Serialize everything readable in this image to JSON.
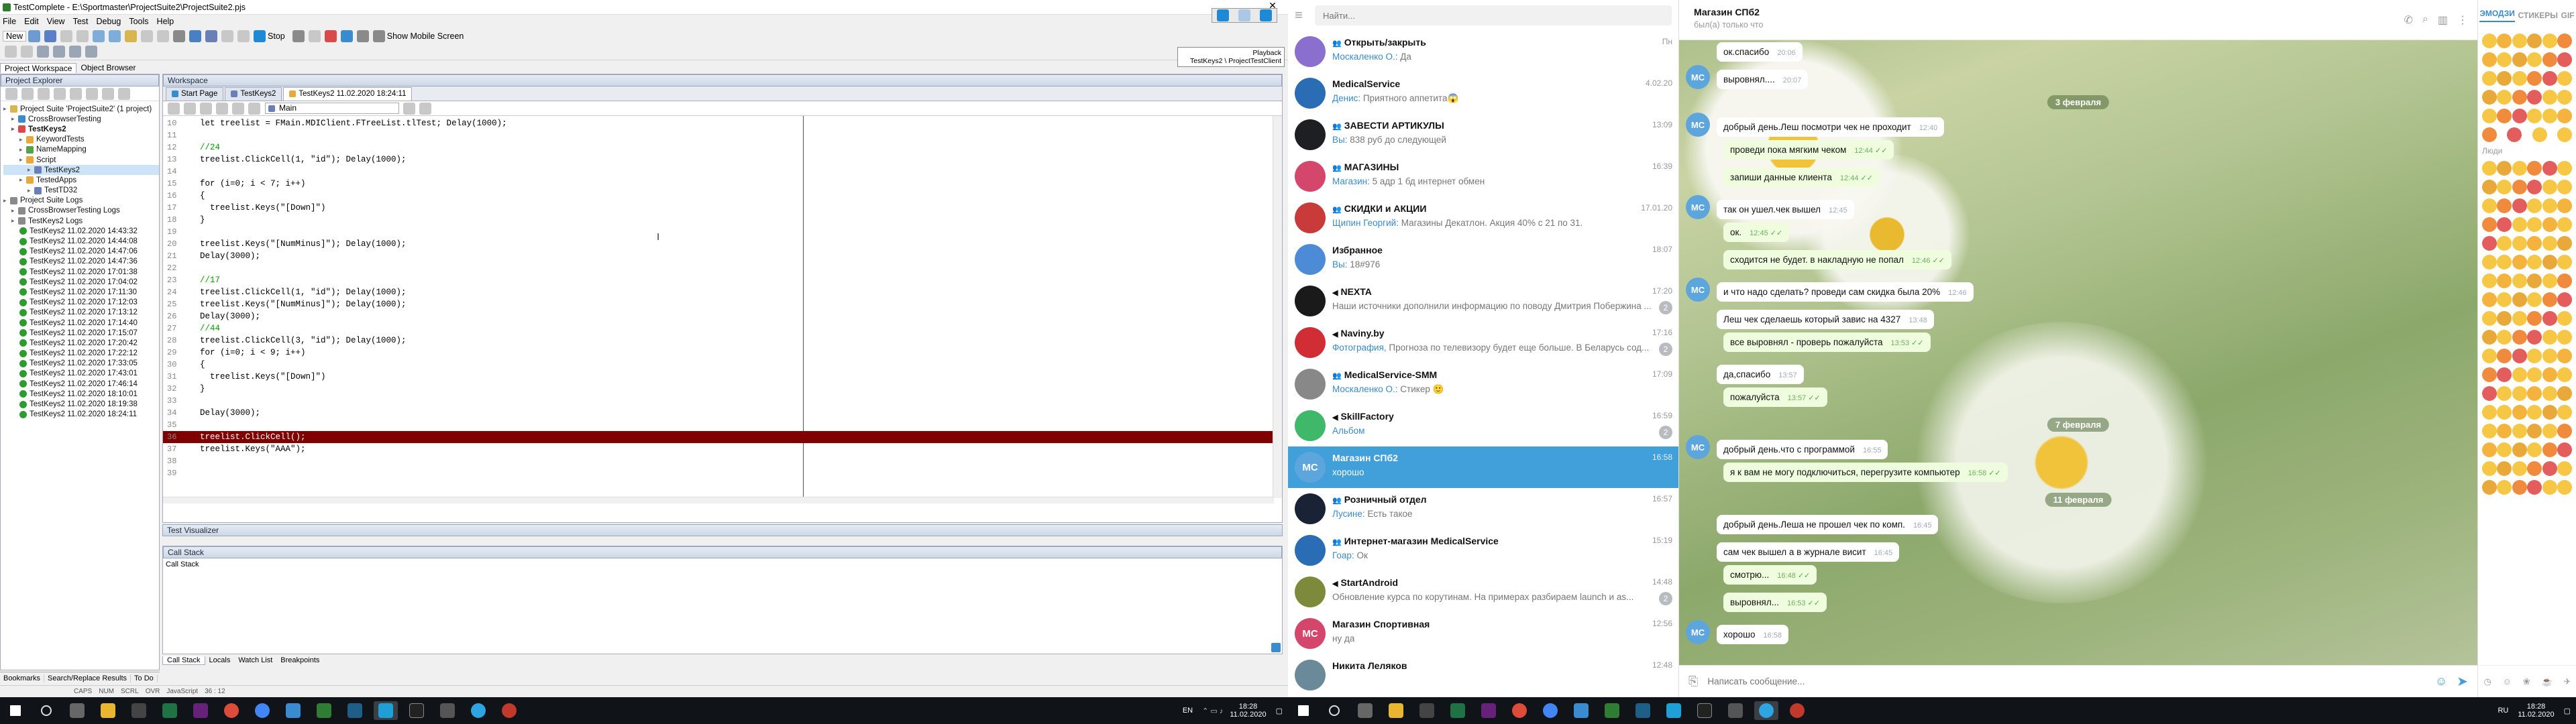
{
  "tc": {
    "title": "TestComplete - E:\\Sportmaster\\ProjectSuite2\\ProjectSuite2.pjs",
    "menu": [
      "File",
      "Edit",
      "View",
      "Test",
      "Debug",
      "Tools",
      "Help"
    ],
    "new_label": "New",
    "stop_label": "Stop",
    "mobile_label": "Show Mobile Screen",
    "tabs_left": [
      "Project Workspace",
      "Object Browser"
    ],
    "explorer_title": "Project Explorer",
    "workspace_title": "Workspace",
    "doc_tabs": [
      "Start Page",
      "TestKeys2",
      "TestKeys2 11.02.2020 18:24:11"
    ],
    "routine": "Main",
    "playback_title": "Playback",
    "playback_caption": "TestKeys2 \\ ProjectTestClient",
    "tree": [
      {
        "t": "Project Suite 'ProjectSuite2' (1 project)",
        "d": 0,
        "c": "#d9b550"
      },
      {
        "t": "CrossBrowserTesting",
        "d": 1,
        "c": "#3b8bd1"
      },
      {
        "t": "TestKeys2",
        "d": 1,
        "c": "#d94b4b",
        "b": true
      },
      {
        "t": "KeywordTests",
        "d": 2,
        "c": "#e7a93c"
      },
      {
        "t": "NameMapping",
        "d": 2,
        "c": "#54a24c"
      },
      {
        "t": "Script",
        "d": 2,
        "c": "#e7a93c"
      },
      {
        "t": "TestKeys2",
        "d": 3,
        "c": "#6a7fb5",
        "sel": true
      },
      {
        "t": "TestedApps",
        "d": 2,
        "c": "#e7a93c"
      },
      {
        "t": "TestTD32",
        "d": 3,
        "c": "#6a7fb5"
      },
      {
        "t": "Project Suite Logs",
        "d": 0,
        "c": "#8a8a8a"
      },
      {
        "t": "CrossBrowserTesting Logs",
        "d": 1,
        "c": "#8a8a8a"
      },
      {
        "t": "TestKeys2 Logs",
        "d": 1,
        "c": "#8a8a8a"
      }
    ],
    "logs": [
      "TestKeys2 11.02.2020 14:43:32",
      "TestKeys2 11.02.2020 14:44:08",
      "TestKeys2 11.02.2020 14:47:06",
      "TestKeys2 11.02.2020 14:47:36",
      "TestKeys2 11.02.2020 17:01:38",
      "TestKeys2 11.02.2020 17:04:02",
      "TestKeys2 11.02.2020 17:11:30",
      "TestKeys2 11.02.2020 17:12:03",
      "TestKeys2 11.02.2020 17:13:12",
      "TestKeys2 11.02.2020 17:14:40",
      "TestKeys2 11.02.2020 17:15:07",
      "TestKeys2 11.02.2020 17:20:42",
      "TestKeys2 11.02.2020 17:22:12",
      "TestKeys2 11.02.2020 17:33:05",
      "TestKeys2 11.02.2020 17:43:01",
      "TestKeys2 11.02.2020 17:46:14",
      "TestKeys2 11.02.2020 18:10:01",
      "TestKeys2 11.02.2020 18:19:38",
      "TestKeys2 11.02.2020 18:24:11"
    ],
    "code": [
      {
        "n": "10",
        "t": "  let treelist = FMain.MDIClient.FTreeList.tlTest; Delay(1000);",
        "k": "code"
      },
      {
        "n": "11",
        "t": "",
        "k": "code"
      },
      {
        "n": "12",
        "t": "  //24",
        "k": "cm"
      },
      {
        "n": "13",
        "t": "  treelist.ClickCell(1, \"id\"); Delay(1000);",
        "k": "code"
      },
      {
        "n": "14",
        "t": "",
        "k": "code"
      },
      {
        "n": "15",
        "t": "  for (i=0; i < 7; i++)",
        "k": "code"
      },
      {
        "n": "16",
        "t": "  {",
        "k": "code"
      },
      {
        "n": "17",
        "t": "    treelist.Keys(\"[Down]\")",
        "k": "code"
      },
      {
        "n": "18",
        "t": "  }",
        "k": "code"
      },
      {
        "n": "19",
        "t": "",
        "k": "code"
      },
      {
        "n": "20",
        "t": "  treelist.Keys(\"[NumMinus]\"); Delay(1000);",
        "k": "code"
      },
      {
        "n": "21",
        "t": "  Delay(3000);",
        "k": "code"
      },
      {
        "n": "22",
        "t": "",
        "k": "code"
      },
      {
        "n": "23",
        "t": "  //17",
        "k": "cm"
      },
      {
        "n": "24",
        "t": "  treelist.ClickCell(1, \"id\"); Delay(1000);",
        "k": "code"
      },
      {
        "n": "25",
        "t": "  treelist.Keys(\"[NumMinus]\"); Delay(1000);",
        "k": "code"
      },
      {
        "n": "26",
        "t": "  Delay(3000);",
        "k": "code"
      },
      {
        "n": "27",
        "t": "  //44",
        "k": "cm"
      },
      {
        "n": "28",
        "t": "  treelist.ClickCell(3, \"id\"); Delay(1000);",
        "k": "code"
      },
      {
        "n": "29",
        "t": "  for (i=0; i < 9; i++)",
        "k": "code"
      },
      {
        "n": "30",
        "t": "  {",
        "k": "code"
      },
      {
        "n": "31",
        "t": "    treelist.Keys(\"[Down]\")",
        "k": "code"
      },
      {
        "n": "32",
        "t": "  }",
        "k": "code"
      },
      {
        "n": "33",
        "t": "",
        "k": "code"
      },
      {
        "n": "34",
        "t": "  Delay(3000);",
        "k": "code"
      },
      {
        "n": "35",
        "t": "",
        "k": "code"
      },
      {
        "n": "36",
        "t": "  treelist.ClickCell();",
        "k": "hl"
      },
      {
        "n": "37",
        "t": "  treelist.Keys(\"AAA\");",
        "k": "code"
      },
      {
        "n": "38",
        "t": "",
        "k": "code"
      },
      {
        "n": "39",
        "t": "",
        "k": "code"
      }
    ],
    "visualizer_title": "Test Visualizer",
    "callstack_title": "Call Stack",
    "callstack_text": "Call Stack",
    "bottom_tabs": [
      "Call Stack",
      "Locals",
      "Watch List",
      "Breakpoints"
    ],
    "left_bottom_tabs": [
      "Bookmarks",
      "Search/Replace Results",
      "To Do"
    ],
    "status": [
      "CAPS",
      "NUM",
      "SCRL",
      "OVR",
      "JavaScript",
      "36 : 12"
    ]
  },
  "tg": {
    "search_placeholder": "Найти...",
    "chats": [
      {
        "name": "Открыть/закрыть",
        "time": "Пн",
        "sender": "Москаленко О.:",
        "text": "Да",
        "color": "#8b6fce",
        "init": "",
        "group": true
      },
      {
        "name": "MedicalService",
        "time": "4.02.20",
        "sender": "Денис:",
        "text": "Приятного аппетита😱",
        "color": "#2a6db5",
        "init": "",
        "group": false
      },
      {
        "name": "ЗАВЕСТИ АРТИКУЛЫ",
        "time": "13:09",
        "sender": "Вы:",
        "text": "838 руб до следующей",
        "color": "#1d1f22",
        "init": "",
        "group": true
      },
      {
        "name": "МАГАЗИНЫ",
        "time": "16:39",
        "sender": "Магазин:",
        "text": "5 адр 1 бд интернет обмен",
        "color": "#d4466b",
        "init": "",
        "group": true
      },
      {
        "name": "СКИДКИ и АКЦИИ",
        "time": "17.01.20",
        "sender": "Щипин Георгий:",
        "text": "Магазины Декатлон. Акция 40% с 21 по 31.",
        "color": "#c93b3b",
        "init": "",
        "group": true
      },
      {
        "name": "Избранное",
        "time": "18:07",
        "sender": "Вы:",
        "text": "18#976",
        "color": "#4d8bd6",
        "init": "",
        "group": false
      },
      {
        "name": "NEXTA",
        "time": "17:20",
        "sender": "",
        "text": "Наши источники дополнили информацию по поводу Дмитрия Побержина ...",
        "color": "#1a1a1a",
        "init": "",
        "group": false,
        "channel": true,
        "badge": "2"
      },
      {
        "name": "Naviny.by",
        "time": "17:16",
        "sender": "Фотография,",
        "text": "Прогноза по телевизору будет еще больше. В Беларусь сод...",
        "color": "#d12d35",
        "init": "",
        "group": false,
        "channel": true,
        "badge": "2"
      },
      {
        "name": "MedicalService-SMM",
        "time": "17:09",
        "sender": "Москаленко О.:",
        "text": "Стикер 🙂",
        "color": "#888",
        "init": "",
        "group": true
      },
      {
        "name": "SkillFactory",
        "time": "16:59",
        "sender": "Альбом",
        "text": "",
        "color": "#3fb86a",
        "init": "",
        "group": false,
        "channel": true,
        "badge": "2"
      },
      {
        "name": "Магазин СПб2",
        "time": "16:58",
        "sender": "",
        "text": "хорошо",
        "color": "#5ca6dd",
        "init": "MC",
        "group": false,
        "active": true
      },
      {
        "name": "Розничный отдел",
        "time": "16:57",
        "sender": "Лусине:",
        "text": "Есть такое",
        "color": "#1a2236",
        "init": "",
        "group": true
      },
      {
        "name": "Интернет-магазин MedicalService",
        "time": "15:19",
        "sender": "Гоар:",
        "text": "Ок",
        "color": "#2a6db5",
        "init": "",
        "group": true
      },
      {
        "name": "StartAndroid",
        "time": "14:48",
        "sender": "",
        "text": "Обновление курса по корутинам. На примерах разбираем launch и as...",
        "color": "#7d8a3c",
        "init": "",
        "group": false,
        "channel": true,
        "badge": "2"
      },
      {
        "name": "Магазин Спортивная",
        "time": "12:56",
        "sender": "",
        "text": "ну да",
        "color": "#d4466b",
        "init": "MC",
        "group": false
      },
      {
        "name": "Никита Леляков",
        "time": "12:48",
        "sender": "",
        "text": "",
        "color": "#6a8a9a",
        "init": "",
        "group": false
      }
    ],
    "header_name": "Магазин СПб2",
    "header_status": "был(а) только что",
    "messages": [
      {
        "t": "ок.спасибо",
        "time": "20:06",
        "out": false,
        "av": false
      },
      {
        "t": "выровнял....",
        "time": "20:07",
        "out": false,
        "av": true,
        "ck": true
      },
      {
        "date": "3 февраля"
      },
      {
        "t": "добрый день.Леш посмотри чек не проходит",
        "time": "12:40",
        "out": false,
        "av": true
      },
      {
        "t": "проведи пока мягким чеком",
        "time": "12:44",
        "out": true,
        "av": false
      },
      {
        "t": "запиши данные клиента",
        "time": "12:44",
        "out": true,
        "av": false
      },
      {
        "t": "так он ушел.чек вышел",
        "time": "12:45",
        "out": false,
        "av": true
      },
      {
        "t": "ок.",
        "time": "12:45",
        "out": true,
        "av": false
      },
      {
        "t": "сходится не будет. в накладную не попал",
        "time": "12:46",
        "out": true,
        "av": false
      },
      {
        "t": "и что надо сделать? проведи сам скидка была 20%",
        "time": "12:46",
        "out": false,
        "av": true
      },
      {
        "t": "Леш чек сделаешь который завис на 4327",
        "time": "13:48",
        "out": false,
        "av": false
      },
      {
        "t": "все выровнял - проверь пожалуйста",
        "time": "13:53",
        "out": true,
        "av": false
      },
      {
        "t": "да,спасибо",
        "time": "13:57",
        "out": false,
        "av": false
      },
      {
        "t": "пожалуйста",
        "time": "13:57",
        "out": true,
        "av": false
      },
      {
        "date": "7 февраля"
      },
      {
        "t": "добрый день.что с программой",
        "time": "16:55",
        "out": false,
        "av": true
      },
      {
        "t": "я к вам не могу подключиться, перегрузите компьютер",
        "time": "16:58",
        "out": true,
        "av": false
      },
      {
        "date": "11 февраля"
      },
      {
        "t": "добрый день.Леша не прошел чек по комп.",
        "time": "16:45",
        "out": false,
        "av": false
      },
      {
        "t": "сам чек вышел а в журнале висит",
        "time": "16:45",
        "out": false,
        "av": false
      },
      {
        "t": "смотрю...",
        "time": "16:48",
        "out": true,
        "av": false
      },
      {
        "t": "выровнял...",
        "time": "16:53",
        "out": true,
        "av": false
      },
      {
        "t": "хорошо",
        "time": "16:58",
        "out": false,
        "av": true
      }
    ],
    "compose_placeholder": "Написать сообщение...",
    "emoji_tabs": [
      "ЭМОДЗИ",
      "СТИКЕРЫ",
      "GIF"
    ],
    "people_label": "Люди"
  },
  "taskbar": {
    "left": {
      "lang": "EN",
      "time": "18:28",
      "date": "11.02.2020"
    },
    "right": {
      "lang": "RU",
      "time": "18:28",
      "date": "11.02.2020"
    }
  }
}
